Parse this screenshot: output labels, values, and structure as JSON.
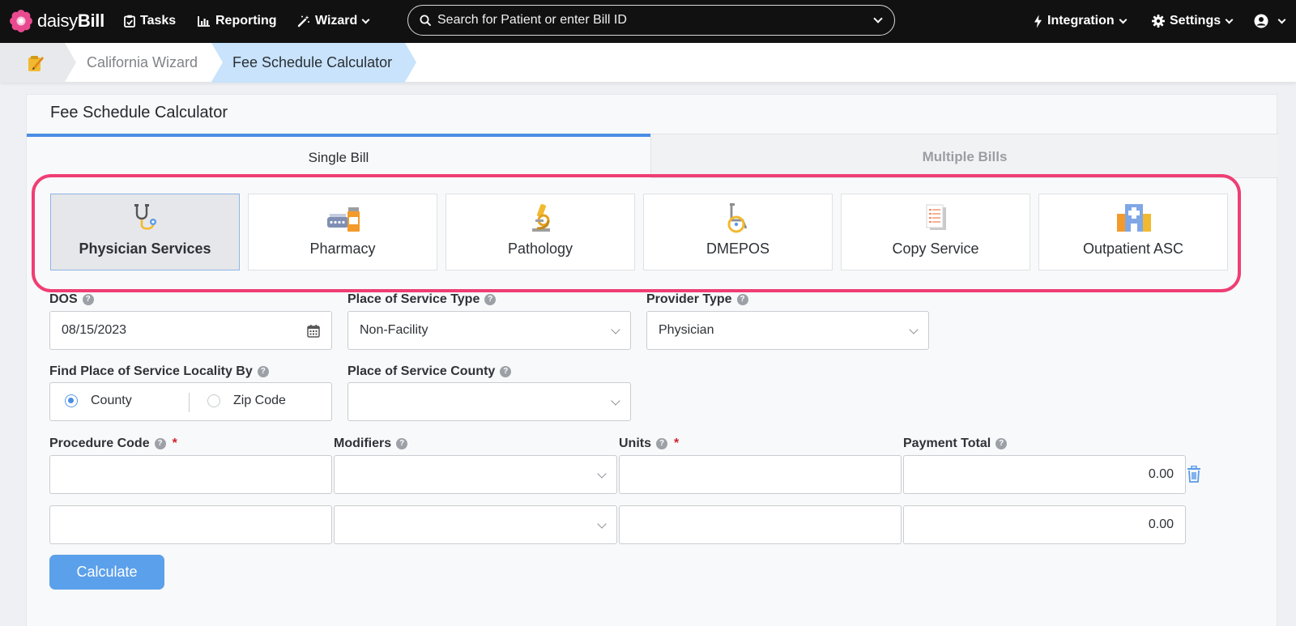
{
  "app": {
    "logo_word_a": "daisy",
    "logo_word_b": "Bill"
  },
  "nav": {
    "tasks": "Tasks",
    "reporting": "Reporting",
    "wizard": "Wizard",
    "integration": "Integration",
    "settings": "Settings"
  },
  "search": {
    "placeholder": "Search for Patient or enter Bill ID"
  },
  "breadcrumb": {
    "parent": "California Wizard",
    "current": "Fee Schedule Calculator"
  },
  "card": {
    "title": "Fee Schedule Calculator"
  },
  "tabs": [
    {
      "label": "Single Bill",
      "active": true
    },
    {
      "label": "Multiple Bills",
      "active": false
    }
  ],
  "services": [
    {
      "label": "Physician Services",
      "icon": "stethoscope-icon",
      "selected": true
    },
    {
      "label": "Pharmacy",
      "icon": "pills-icon",
      "selected": false
    },
    {
      "label": "Pathology",
      "icon": "microscope-icon",
      "selected": false
    },
    {
      "label": "DMEPOS",
      "icon": "wheelchair-icon",
      "selected": false
    },
    {
      "label": "Copy Service",
      "icon": "document-copy-icon",
      "selected": false
    },
    {
      "label": "Outpatient ASC",
      "icon": "hospital-icon",
      "selected": false
    }
  ],
  "form": {
    "dos_label": "DOS",
    "dos_value": "08/15/2023",
    "pos_type_label": "Place of Service Type",
    "pos_type_value": "Non-Facility",
    "provider_type_label": "Provider Type",
    "provider_type_value": "Physician",
    "locality_label": "Find Place of Service Locality By",
    "locality_options": [
      "County",
      "Zip Code"
    ],
    "locality_selected": "County",
    "county_label": "Place of Service County",
    "county_value": "",
    "procedure_label": "Procedure Code",
    "modifiers_label": "Modifiers",
    "units_label": "Units",
    "payment_label": "Payment Total",
    "required_mark": "*",
    "rows": [
      {
        "procedure": "",
        "modifiers": "",
        "units": "",
        "payment": "0.00"
      },
      {
        "procedure": "",
        "modifiers": "",
        "units": "",
        "payment": "0.00"
      }
    ],
    "calculate_label": "Calculate"
  },
  "colors": {
    "topbar": "#111111",
    "accent": "#4a8ee4",
    "breadcrumb_active": "#c8e3fb",
    "highlight": "#ef3e74",
    "required": "#d0222f"
  }
}
